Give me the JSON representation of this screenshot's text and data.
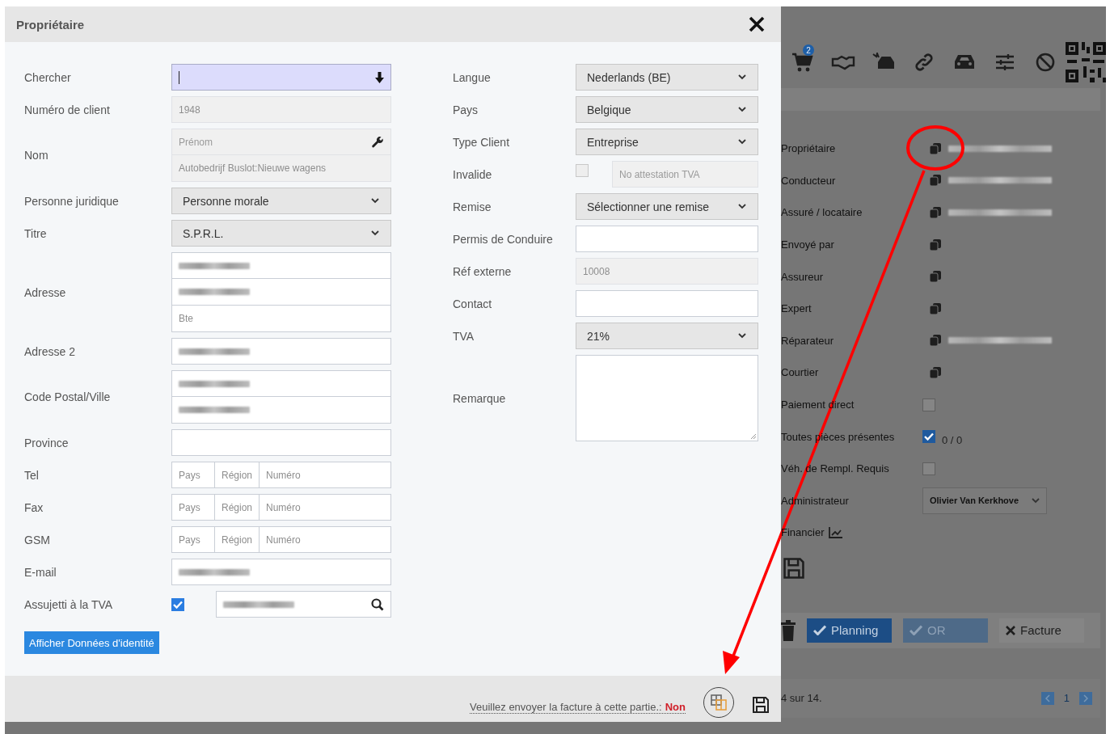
{
  "dialog": {
    "title": "Propriétaire",
    "left_fields": [
      {
        "kind": "search",
        "label": "Chercher"
      },
      {
        "kind": "text",
        "label": "Numéro de client",
        "value": "1948",
        "disabled": true
      },
      {
        "kind": "stack",
        "label": "Nom",
        "inputs": [
          {
            "placeholder": "Prénom",
            "disabled": true,
            "tool": true
          },
          {
            "value": "Autobedrijf Buslot:Nieuwe wagens",
            "disabled": true
          }
        ]
      },
      {
        "kind": "select",
        "label": "Personne juridique",
        "value": "Personne morale"
      },
      {
        "kind": "select",
        "label": "Titre",
        "value": "S.P.R.L."
      },
      {
        "kind": "stack",
        "label": "Adresse",
        "inputs": [
          {
            "redacted": true
          },
          {
            "redacted": true
          },
          {
            "placeholder": "Bte"
          }
        ]
      },
      {
        "kind": "text",
        "label": "Adresse 2",
        "redacted": true
      },
      {
        "kind": "stack",
        "label": "Code Postal/Ville",
        "inputs": [
          {
            "redacted": true
          },
          {
            "redacted": true
          }
        ]
      },
      {
        "kind": "text",
        "label": "Province"
      },
      {
        "kind": "phone",
        "label": "Tel",
        "placeholders": [
          "Pays",
          "Région",
          "Numéro"
        ]
      },
      {
        "kind": "phone",
        "label": "Fax",
        "placeholders": [
          "Pays",
          "Région",
          "Numéro"
        ]
      },
      {
        "kind": "phone",
        "label": "GSM",
        "placeholders": [
          "Pays",
          "Région",
          "Numéro"
        ]
      },
      {
        "kind": "text",
        "label": "E-mail",
        "redacted": true
      },
      {
        "kind": "vat",
        "label": "Assujetti à la TVA",
        "checked": true,
        "redacted": true
      }
    ],
    "identity_button": "Afficher Données d'identité",
    "right_fields": [
      {
        "kind": "select",
        "label": "Langue",
        "value": "Nederlands (BE)"
      },
      {
        "kind": "select",
        "label": "Pays",
        "value": "Belgique"
      },
      {
        "kind": "select",
        "label": "Type Client",
        "value": "Entreprise"
      },
      {
        "kind": "check_input",
        "label": "Invalide",
        "checked": false,
        "placeholder": "No attestation TVA",
        "disabled": true
      },
      {
        "kind": "select",
        "label": "Remise",
        "value": "Sélectionner une remise"
      },
      {
        "kind": "text",
        "label": "Permis de Conduire"
      },
      {
        "kind": "text",
        "label": "Réf externe",
        "value": "10008",
        "disabled": true
      },
      {
        "kind": "text",
        "label": "Contact"
      },
      {
        "kind": "select",
        "label": "TVA",
        "value": "21%"
      },
      {
        "kind": "textarea",
        "label": "Remarque"
      }
    ],
    "footer": {
      "invoice_label": "Veuillez envoyer la facture à cette partie.:",
      "invoice_value": "Non"
    }
  },
  "background": {
    "cart_badge": "2",
    "rows": [
      {
        "kind": "contact",
        "label": "Propriétaire",
        "redacted": true
      },
      {
        "kind": "contact",
        "label": "Conducteur",
        "redacted": true
      },
      {
        "kind": "contact",
        "label": "Assuré / locataire",
        "redacted": true
      },
      {
        "kind": "contact",
        "label": "Envoyé par",
        "redacted": false
      },
      {
        "kind": "contact",
        "label": "Assureur",
        "redacted": false
      },
      {
        "kind": "contact",
        "label": "Expert",
        "redacted": false
      },
      {
        "kind": "contact",
        "label": "Réparateur",
        "redacted": true
      },
      {
        "kind": "contact",
        "label": "Courtier",
        "redacted": false
      },
      {
        "kind": "checkbox",
        "label": "Paiement direct",
        "checked": false
      },
      {
        "kind": "checkbox",
        "label": "Toutes pièces présentes",
        "checked": true,
        "count": "0 / 0"
      },
      {
        "kind": "checkbox",
        "label": "Véh. de Rempl. Requis",
        "checked": false
      },
      {
        "kind": "select",
        "label": "Administrateur",
        "value": "Olivier Van Kerkhove"
      },
      {
        "kind": "chart",
        "label": "Financier"
      }
    ],
    "actions": [
      {
        "label": "Planning",
        "checked": true,
        "disabled": false
      },
      {
        "label": "OR",
        "checked": true,
        "disabled": true
      },
      {
        "label": "Facture",
        "checked": false,
        "disabled": false
      }
    ],
    "pagination": {
      "summary": "4 sur 14.",
      "page": "1"
    }
  }
}
